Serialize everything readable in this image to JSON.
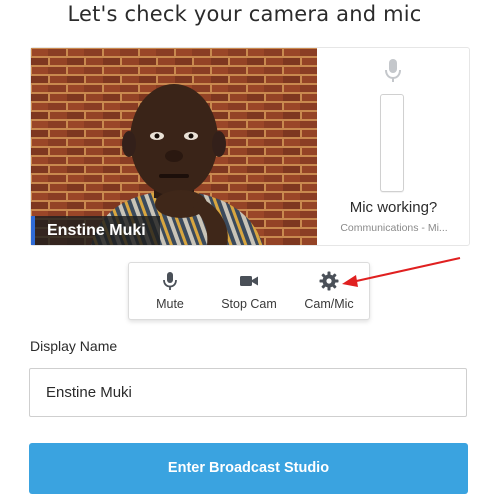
{
  "page": {
    "title": "Let's check your camera and mic"
  },
  "preview": {
    "participant_name": "Enstine Muki",
    "mic_status": "Mic working?",
    "mic_device": "Communications - Mi...",
    "mic_icon": "microphone-icon"
  },
  "controls": [
    {
      "label": "Mute",
      "icon": "microphone-icon"
    },
    {
      "label": "Stop Cam",
      "icon": "video-camera-icon"
    },
    {
      "label": "Cam/Mic",
      "icon": "gear-icon"
    }
  ],
  "form": {
    "display_name_label": "Display Name",
    "display_name_value": "Enstine Muki"
  },
  "actions": {
    "enter_label": "Enter Broadcast Studio"
  },
  "colors": {
    "primary_button": "#3aa3e0",
    "name_tag_accent": "#2f6bd6",
    "annotation_arrow": "#e02020",
    "icon_color": "#4a5058"
  }
}
